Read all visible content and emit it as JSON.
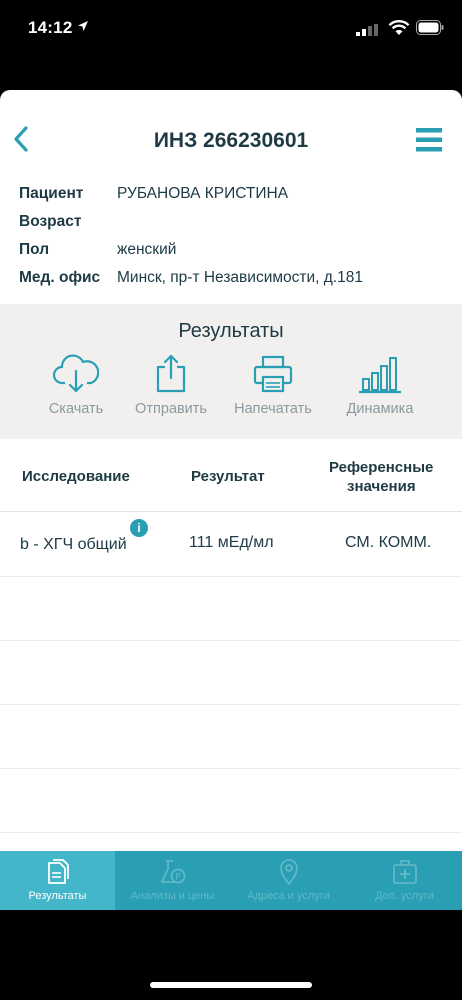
{
  "status_bar": {
    "time": "14:12"
  },
  "header": {
    "title": "ИНЗ 266230601"
  },
  "patient": {
    "rows": [
      {
        "label": "Пациент",
        "value": "РУБАНОВА КРИСТИНА"
      },
      {
        "label": "Возраст",
        "value": ""
      },
      {
        "label": "Пол",
        "value": "женский"
      },
      {
        "label": "Мед. офис",
        "value": "Минск, пр-т Независимости, д.181"
      }
    ]
  },
  "results": {
    "title": "Результаты",
    "actions": [
      {
        "label": "Скачать",
        "icon": "cloud-download-icon"
      },
      {
        "label": "Отправить",
        "icon": "share-icon"
      },
      {
        "label": "Напечатать",
        "icon": "printer-icon"
      },
      {
        "label": "Динамика",
        "icon": "bar-chart-icon"
      }
    ]
  },
  "table": {
    "headers": {
      "study": "Исследование",
      "result": "Результат",
      "reference_line1": "Референсные",
      "reference_line2": "значения"
    },
    "rows": [
      {
        "study": "b - ХГЧ общий",
        "result": "111 мЕд/мл",
        "reference": "СМ. КОММ.",
        "info_badge": "i"
      }
    ]
  },
  "tabbar": {
    "tabs": [
      {
        "label": "Результаты",
        "icon": "document-icon",
        "active": true
      },
      {
        "label": "Анализы и цены",
        "icon": "flask-icon",
        "active": false
      },
      {
        "label": "Адреса и услуги",
        "icon": "map-pin-icon",
        "active": false
      },
      {
        "label": "Доп. услуги",
        "icon": "medical-bag-icon",
        "active": false
      }
    ]
  },
  "colors": {
    "accent": "#2a9fb4",
    "text_dark": "#1d3a45",
    "panel_bg": "#f1f0ef"
  }
}
